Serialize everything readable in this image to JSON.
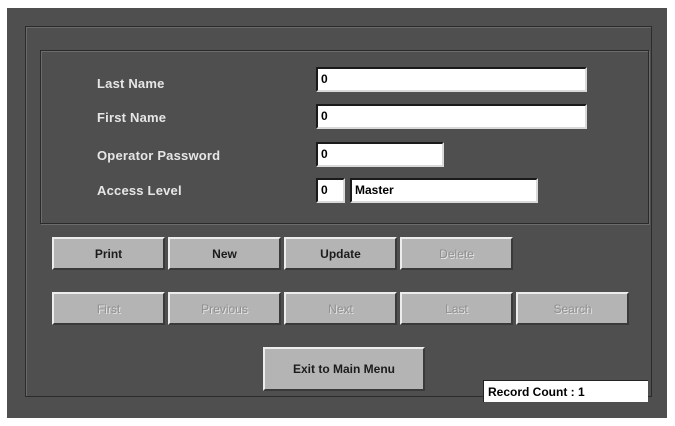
{
  "form": {
    "fields": [
      {
        "label": "Last Name",
        "value": "0"
      },
      {
        "label": "First Name",
        "value": "0"
      },
      {
        "label": "Operator Password",
        "value": "0"
      },
      {
        "label": "Access Level",
        "value": "0",
        "extra_value": "Master"
      }
    ]
  },
  "buttons": {
    "row1": [
      {
        "label": "Print",
        "enabled": true
      },
      {
        "label": "New",
        "enabled": true
      },
      {
        "label": "Update",
        "enabled": true
      },
      {
        "label": "Delete",
        "enabled": false
      }
    ],
    "row2": [
      {
        "label": "First",
        "enabled": false
      },
      {
        "label": "Previous",
        "enabled": false
      },
      {
        "label": "Next",
        "enabled": false
      },
      {
        "label": "Last",
        "enabled": false
      },
      {
        "label": "Search",
        "enabled": false
      }
    ],
    "exit": {
      "label": "Exit to Main Menu",
      "enabled": true
    }
  },
  "status": {
    "record_count": "Record Count : 1"
  },
  "colors": {
    "background": "#4f4f4f",
    "button": "#b4b4b4",
    "label_text": "#e6e6e6"
  }
}
